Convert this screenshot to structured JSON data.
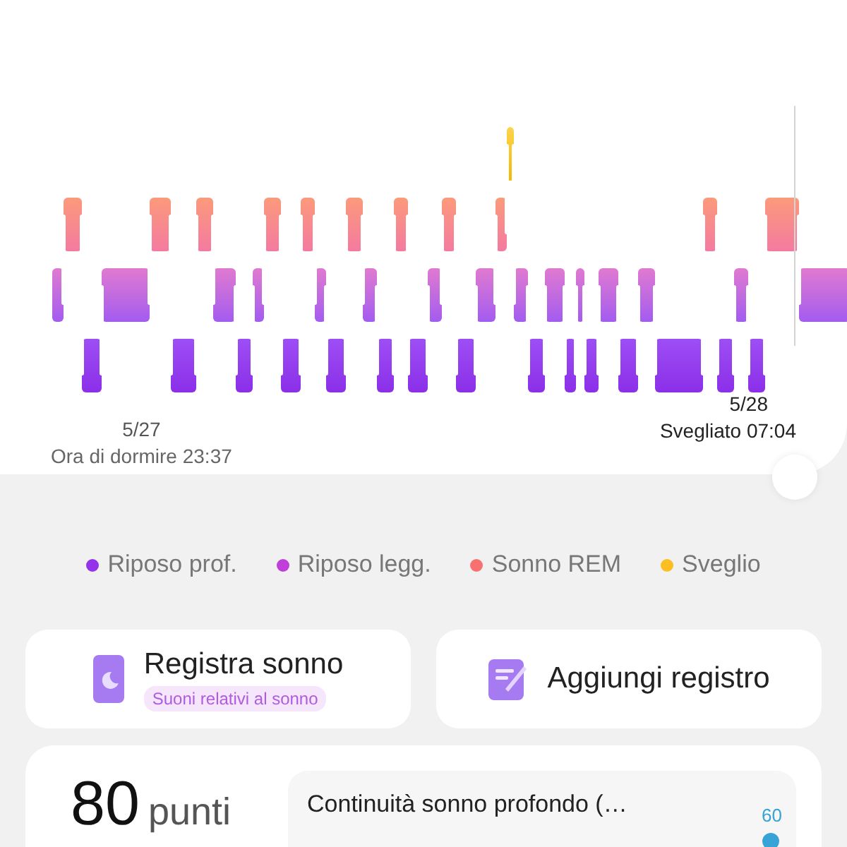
{
  "chart": {
    "start_date": "5/27",
    "start_label": "Ora di dormire 23:37",
    "end_date": "5/28",
    "end_label": "Svegliato 07:04"
  },
  "legend": [
    {
      "label": "Riposo prof.",
      "color": "#9333ea"
    },
    {
      "label": "Riposo legg.",
      "color": "#c03fd8"
    },
    {
      "label": "Sonno REM",
      "color": "#f87171"
    },
    {
      "label": "Sveglio",
      "color": "#fbbf24"
    }
  ],
  "actions": [
    {
      "kind": "record",
      "label": "Registra sonno",
      "badge": "Suoni relativi al sonno"
    },
    {
      "kind": "add",
      "label": "Aggiungi registro"
    }
  ],
  "score": {
    "value": "80",
    "unit": "punti"
  },
  "detail": {
    "title": "Continuità sonno profondo (…",
    "reading": "60"
  }
}
